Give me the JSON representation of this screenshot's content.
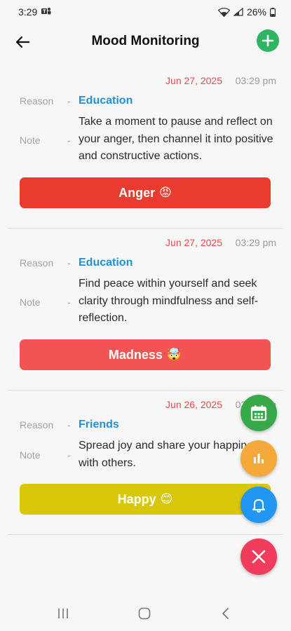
{
  "status_bar": {
    "time": "3:29",
    "battery": "26%"
  },
  "app_bar": {
    "title": "Mood Monitoring"
  },
  "labels": {
    "reason": "Reason",
    "note": "Note",
    "dash": "-"
  },
  "entries": [
    {
      "date": "Jun 27, 2025",
      "time": "03:29 pm",
      "reason": "Education",
      "note": "Take a moment to pause and reflect on your anger, then channel it into positive and constructive actions.",
      "mood": "Anger",
      "emoji": "😡",
      "color": "#ea3b31"
    },
    {
      "date": "Jun 27, 2025",
      "time": "03:29 pm",
      "reason": "Education",
      "note": "Find peace within yourself and seek clarity through mindfulness and self-reflection.",
      "mood": "Madness",
      "emoji": "🤯",
      "color": "#f25353"
    },
    {
      "date": "Jun 26, 2025",
      "time": "03:29 pm",
      "reason": "Friends",
      "note": "Spread joy and share your happiness with others.",
      "mood": "Happy",
      "emoji": "😊",
      "color": "#d9c709"
    }
  ],
  "fab_menu": [
    {
      "icon": "calendar-icon",
      "color": "#37a94a"
    },
    {
      "icon": "chart-icon",
      "color": "#f5a93a"
    },
    {
      "icon": "bell-icon",
      "color": "#2196f3"
    },
    {
      "icon": "close-icon",
      "color": "#f23c5c"
    }
  ],
  "nav_bar": {
    "icons": [
      "recents-icon",
      "home-icon",
      "back-icon"
    ]
  }
}
